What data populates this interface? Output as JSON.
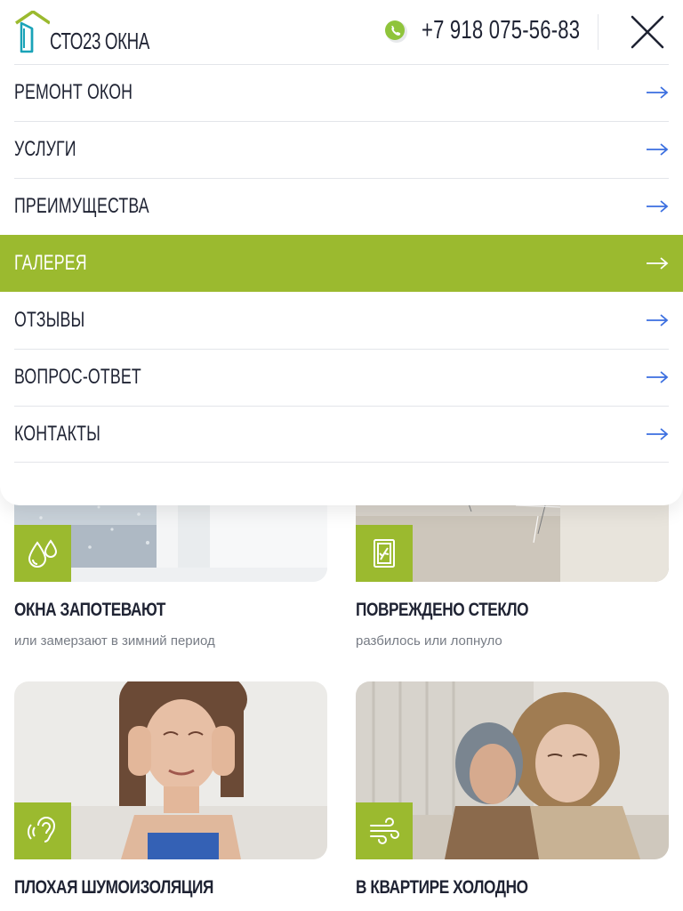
{
  "header": {
    "logo_text": "СТО23 ОКНА",
    "phone": "+7 918 075-56-83"
  },
  "menu": {
    "items": [
      {
        "label": "РЕМОНТ ОКОН",
        "active": false
      },
      {
        "label": "УСЛУГИ",
        "active": false
      },
      {
        "label": "ПРЕИМУЩЕСТВА",
        "active": false
      },
      {
        "label": "ГАЛЕРЕЯ",
        "active": true
      },
      {
        "label": "ОТЗЫВЫ",
        "active": false
      },
      {
        "label": "ВОПРОС-ОТВЕТ",
        "active": false
      },
      {
        "label": "КОНТАКТЫ",
        "active": false
      }
    ]
  },
  "cards": [
    {
      "title": "ОКНА ЗАПОТЕВАЮТ",
      "subtitle": "или замерзают в зимний период",
      "icon": "water-drops-icon"
    },
    {
      "title": "ПОВРЕЖДЕНО СТЕКЛО",
      "subtitle": "разбилось или лопнуло",
      "icon": "broken-glass-icon"
    },
    {
      "title": "ПЛОХАЯ ШУМОИЗОЛЯЦИЯ",
      "icon": "ear-sound-icon"
    },
    {
      "title": "В КВАРТИРЕ ХОЛОДНО",
      "icon": "wind-icon"
    }
  ],
  "colors": {
    "accent": "#9bba2f",
    "arrow": "#3b6fe0",
    "text": "#1f2333",
    "muted": "#777c85",
    "whatsapp": "#8fc43b"
  }
}
